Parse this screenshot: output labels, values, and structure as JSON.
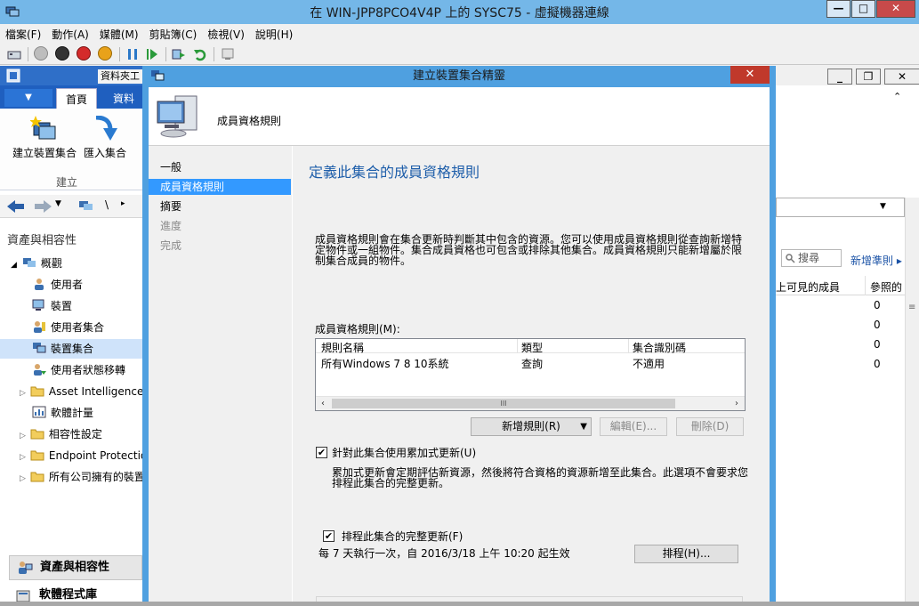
{
  "vm": {
    "title": "在 WIN-JPP8PCO4V4P 上的 SYSC75 - 虛擬機器連線",
    "min_label": "—",
    "max_label": "□",
    "close_label": "✕",
    "menu": [
      "檔案(F)",
      "動作(A)",
      "媒體(M)",
      "剪貼簿(C)",
      "檢視(V)",
      "說明(H)"
    ]
  },
  "console": {
    "folder_tab": "資料夾工",
    "tab_home": "首頁",
    "tab_folder": "資料夾",
    "btn_create_collection": "建立裝置集合",
    "btn_import_collection": "匯入集合",
    "group_create": "建立",
    "nav_path": "\\",
    "tree_heading": "資產與相容性",
    "tree": [
      {
        "label": "概觀"
      },
      {
        "label": "使用者"
      },
      {
        "label": "裝置"
      },
      {
        "label": "使用者集合"
      },
      {
        "label": "裝置集合"
      },
      {
        "label": "使用者狀態移轉"
      },
      {
        "label": "Asset Intelligence"
      },
      {
        "label": "軟體計量"
      },
      {
        "label": "相容性設定"
      },
      {
        "label": "Endpoint Protection"
      },
      {
        "label": "所有公司擁有的裝置"
      }
    ],
    "workspace_selected": "資產與相容性",
    "workspace_next": "軟體程式庫",
    "right_search": "搜尋",
    "right_link": "新增準則",
    "right_col1": "上可見的成員",
    "right_col2": "參照的",
    "right_values": [
      "0",
      "0",
      "0",
      "0"
    ]
  },
  "wizard": {
    "title": "建立裝置集合精靈",
    "close_label": "✕",
    "header_title": "成員資格規則",
    "nav": [
      {
        "label": "一般"
      },
      {
        "label": "成員資格規則"
      },
      {
        "label": "摘要"
      },
      {
        "label": "進度"
      },
      {
        "label": "完成"
      }
    ],
    "heading": "定義此集合的成員資格規則",
    "intro_line1": "成員資格規則會在集合更新時判斷其中包含的資源。您可以使用成員資格規則從查詢新增特",
    "intro_line2": "定物件或一組物件。集合成員資格也可包含或排除其他集合。成員資格規則只能新增屬於限",
    "intro_line3": "制集合成員的物件。",
    "rules_label": "成員資格規則(M):",
    "table": {
      "headers": [
        "規則名稱",
        "類型",
        "集合識別碼"
      ],
      "rows": [
        [
          "所有Windows 7 8 10系統",
          "查詢",
          "不適用"
        ]
      ]
    },
    "scroll_grip": "III",
    "btn_add_rule": "新增規則(R)",
    "btn_edit": "編輯(E)...",
    "btn_delete": "刪除(D)",
    "chk_incremental_label": "針對此集合使用累加式更新(U)",
    "chk_incremental_checked": true,
    "incremental_desc_line1": "累加式更新會定期評估新資源，然後將符合資格的資源新增至此集合。此選項不會要求您",
    "incremental_desc_line2": "排程此集合的完整更新。",
    "chk_schedule_label": "排程此集合的完整更新(F)",
    "chk_schedule_checked": true,
    "schedule_text": "每 7 天執行一次，自 2016/3/18 上午 10:20 起生效",
    "btn_schedule": "排程(H)..."
  }
}
